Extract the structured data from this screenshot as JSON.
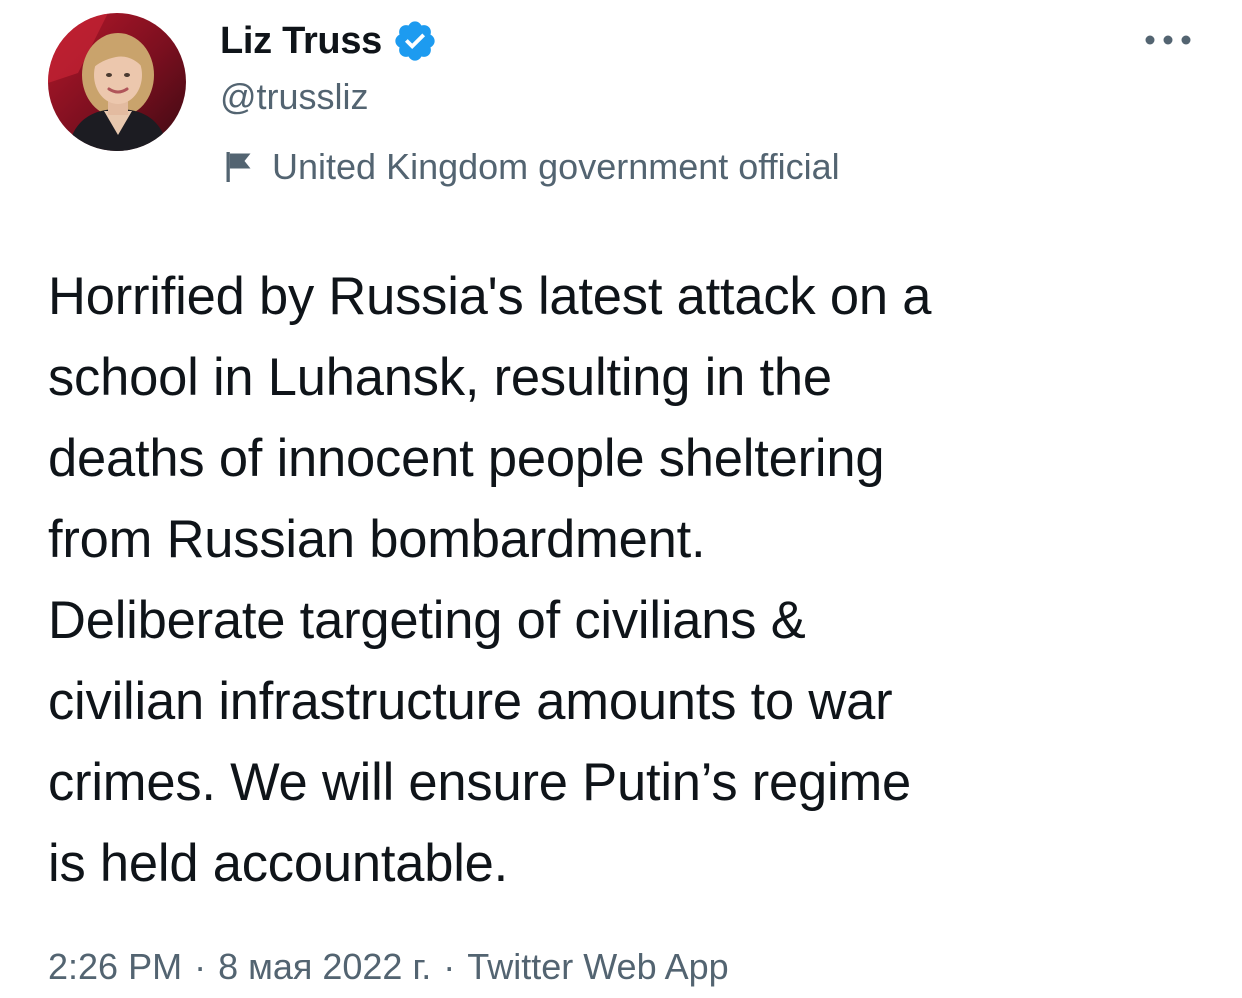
{
  "author": {
    "display_name": "Liz Truss",
    "handle": "@trussliz",
    "verified": true,
    "label": "United Kingdom government official",
    "avatar_icon": "profile-photo"
  },
  "tweet": {
    "text": "Horrified by Russia's latest attack on a\nschool in Luhansk, resulting in the\ndeaths of innocent people sheltering\nfrom Russian bombardment.\nDeliberate targeting of civilians &\ncivilian infrastructure amounts to war\ncrimes. We will ensure Putin’s regime\nis held accountable."
  },
  "meta": {
    "time": "2:26 PM",
    "separator": "·",
    "date": "8 мая 2022 г.",
    "source": "Twitter Web App"
  },
  "icons": {
    "verified": "verified-badge-icon",
    "label": "flag-icon",
    "more": "more-options-icon"
  },
  "colors": {
    "verified_blue": "#1d9bf0",
    "secondary_text": "#536471",
    "primary_text": "#0f1419"
  }
}
